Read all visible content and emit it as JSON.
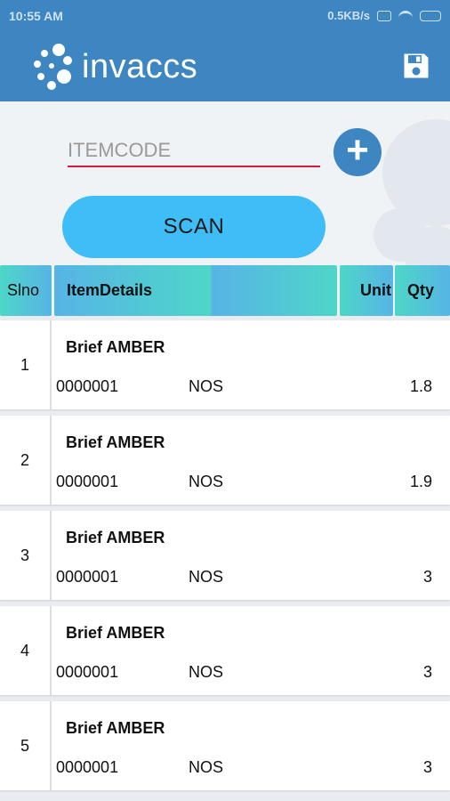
{
  "status": {
    "time": "10:55 AM",
    "net_speed": "0.5KB/s"
  },
  "app": {
    "brand": "invaccs"
  },
  "form": {
    "itemcode_placeholder": "ITEMCODE",
    "add_label": "+",
    "scan_label": "SCAN"
  },
  "table": {
    "headers": {
      "slno": "Slno",
      "item": "ItemDetails",
      "unit": "Unit",
      "qty": "Qty"
    },
    "rows": [
      {
        "slno": "1",
        "name": "Brief AMBER",
        "code": "0000001",
        "unit": "NOS",
        "qty": "1.8"
      },
      {
        "slno": "2",
        "name": "Brief AMBER",
        "code": "0000001",
        "unit": "NOS",
        "qty": "1.9"
      },
      {
        "slno": "3",
        "name": "Brief AMBER",
        "code": "0000001",
        "unit": "NOS",
        "qty": "3"
      },
      {
        "slno": "4",
        "name": "Brief AMBER",
        "code": "0000001",
        "unit": "NOS",
        "qty": "3"
      },
      {
        "slno": "5",
        "name": "Brief AMBER",
        "code": "0000001",
        "unit": "NOS",
        "qty": "3"
      }
    ]
  },
  "icons": {
    "save": "save-icon",
    "logo": "invaccs-logo",
    "add": "plus-icon"
  },
  "colors": {
    "primary": "#3d86c2",
    "scan": "#3fbdf6",
    "underline": "#d81b3c",
    "header_teal": "#4ed6c8",
    "header_blue": "#57b4e6"
  }
}
